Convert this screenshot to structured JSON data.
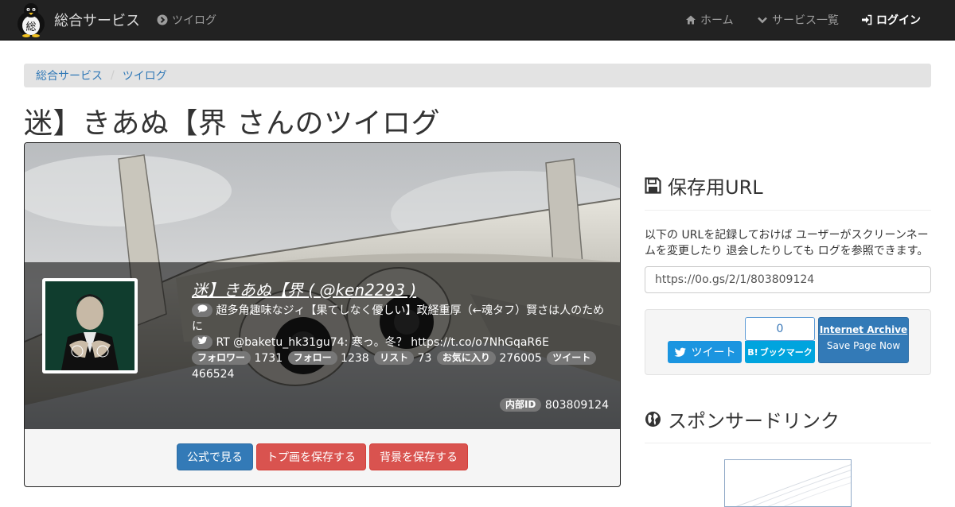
{
  "navbar": {
    "brand": "総合サービス",
    "brand_glyph": "総",
    "section_link": "ツイログ",
    "home": "ホーム",
    "services": "サービス一覧",
    "login": "ログイン"
  },
  "breadcrumb": [
    "総合サービス",
    "ツイログ"
  ],
  "page": {
    "title": "迷】きあぬ【界 さんのツイログ"
  },
  "profile": {
    "name": "迷】きあぬ【界 ( @ken2293 )",
    "bio": "超多角趣味なジィ【果てしなく優しい】政経重厚（←魂タフ）賢さは人のために",
    "latest_tweet": "RT @baketu_hk31gu74: 寒っ。冬？ https://t.co/o7NhGqaR6E",
    "stats": {
      "followers_label": "フォロワー",
      "followers": "1731",
      "following_label": "フォロー",
      "following": "1238",
      "lists_label": "リスト",
      "lists": "73",
      "favorites_label": "お気に入り",
      "favorites": "276005",
      "tweets_label": "ツイート",
      "tweets": "466524"
    },
    "internal_id_label": "内部ID",
    "internal_id": "803809124"
  },
  "actions": {
    "view_official": "公式で見る",
    "save_icon": "トプ画を保存する",
    "save_background": "背景を保存する"
  },
  "sidebar": {
    "save_url_heading": "保存用URL",
    "save_url_desc": "以下の URLを記録しておけば ユーザーがスクリーンネームを変更したり 退会したりしても ログを参照できます。",
    "save_url_value": "https://0o.gs/2/1/803809124",
    "tweet_button": "ツイート",
    "hatena_count": "0",
    "hatena_label": "ブックマーク",
    "hatena_mark": "B!",
    "ia_title": "Internet Archive",
    "ia_action": "Save Page Now",
    "sponsored_heading": "スポンサードリンク"
  },
  "colors": {
    "navbar_bg": "#222222",
    "primary": "#337ab7",
    "danger": "#d9534f",
    "badge": "#777777",
    "twitter": "#1b95e0",
    "hatena": "#00a4de"
  }
}
